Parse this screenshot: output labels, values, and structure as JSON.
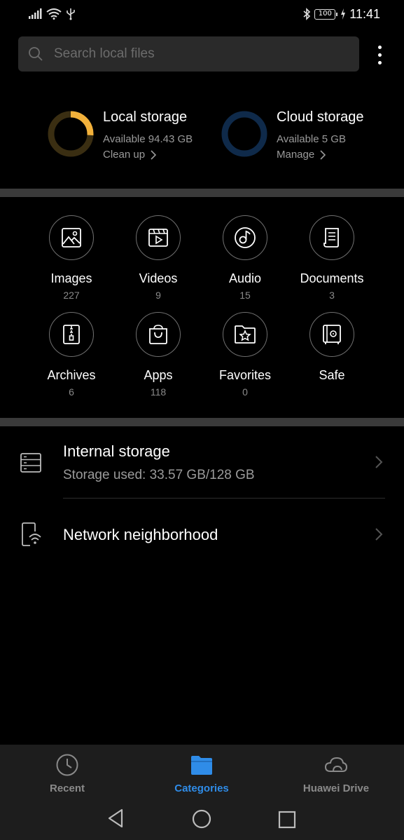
{
  "status_bar": {
    "time": "11:41",
    "battery": "100",
    "icons": [
      "signal-icon",
      "wifi-icon",
      "usb-icon",
      "bluetooth-icon",
      "battery-icon",
      "charging-icon"
    ]
  },
  "search": {
    "placeholder": "Search local files"
  },
  "storage": {
    "local": {
      "title": "Local storage",
      "available": "Available 94.43 GB",
      "action": "Clean up",
      "used_fraction": 0.26,
      "color": "#f2b13b"
    },
    "cloud": {
      "title": "Cloud storage",
      "available": "Available 5 GB",
      "action": "Manage",
      "used_fraction": 0,
      "color": "#1e4f8a"
    }
  },
  "categories": [
    {
      "label": "Images",
      "count": "227",
      "icon": "image-icon"
    },
    {
      "label": "Videos",
      "count": "9",
      "icon": "video-icon"
    },
    {
      "label": "Audio",
      "count": "15",
      "icon": "audio-icon"
    },
    {
      "label": "Documents",
      "count": "3",
      "icon": "document-icon"
    },
    {
      "label": "Archives",
      "count": "6",
      "icon": "archive-icon"
    },
    {
      "label": "Apps",
      "count": "118",
      "icon": "apps-icon"
    },
    {
      "label": "Favorites",
      "count": "0",
      "icon": "favorites-icon"
    },
    {
      "label": "Safe",
      "count": "",
      "icon": "safe-icon"
    }
  ],
  "locations": {
    "internal": {
      "title": "Internal storage",
      "subtitle": "Storage used: 33.57 GB/128 GB"
    },
    "network": {
      "title": "Network neighborhood"
    }
  },
  "bottom_nav": {
    "tabs": [
      {
        "label": "Recent",
        "icon": "clock-icon",
        "active": false
      },
      {
        "label": "Categories",
        "icon": "folder-icon",
        "active": true
      },
      {
        "label": "Huawei Drive",
        "icon": "cloud-icon",
        "active": false
      }
    ],
    "active_color": "#2f8ce8"
  },
  "system_nav": [
    "back-icon",
    "home-icon",
    "recents-icon"
  ]
}
